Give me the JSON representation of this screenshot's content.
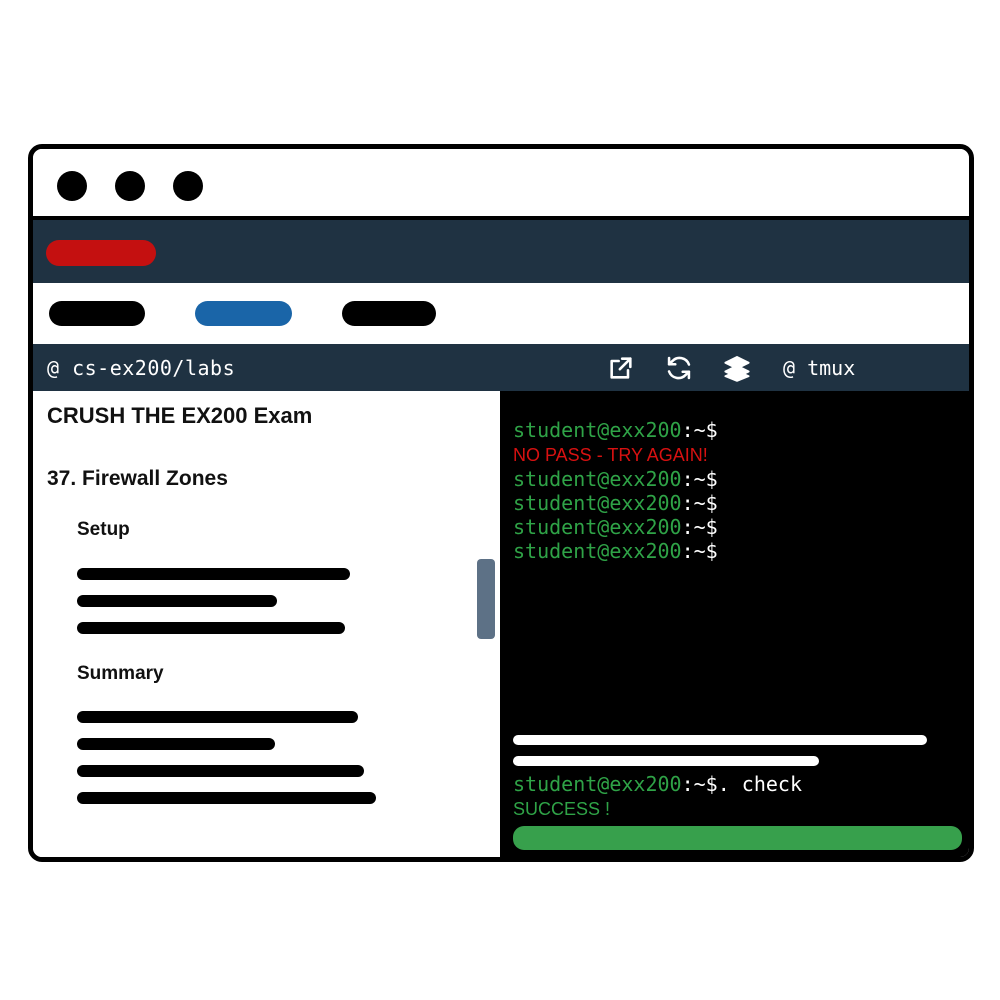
{
  "window": {
    "traffic_lights": [
      "close",
      "minimize",
      "maximize"
    ],
    "frame_color": "#000000"
  },
  "brandbar": {
    "color": "#1f3242",
    "logo_pill_color": "#c41010"
  },
  "navbar": {
    "pills": [
      {
        "name": "nav-pill-1",
        "color": "#000000",
        "active": false
      },
      {
        "name": "nav-pill-2",
        "color": "#1a65a8",
        "active": true
      },
      {
        "name": "nav-pill-3",
        "color": "#000000",
        "active": false
      }
    ]
  },
  "pathbar": {
    "path": "@ cs-ex200/labs",
    "background": "#1f3242",
    "icons": [
      {
        "name": "external-link-icon",
        "label": "open-in-new-window"
      },
      {
        "name": "refresh-icon",
        "label": "reload"
      },
      {
        "name": "layers-icon",
        "label": "layers"
      }
    ],
    "tmux_label": "@ tmux"
  },
  "document": {
    "title": "CRUSH THE EX200 Exam",
    "section": "37. Firewall Zones",
    "subsections": [
      {
        "heading": "Setup",
        "redacted_lines": 3
      },
      {
        "heading": "Summary",
        "redacted_lines": 4
      }
    ],
    "scrollbar_color": "#5d7186"
  },
  "terminal": {
    "background": "#000000",
    "prompt": "student@exx200",
    "prompt_suffix": ":~$",
    "prompt_color": "#2fa347",
    "suffix_color": "#ffffff",
    "lines": [
      {
        "type": "prompt",
        "prompt": "student@exx200",
        "suffix": ":~$",
        "command": ""
      },
      {
        "type": "error",
        "text": "NO PASS - TRY AGAIN!",
        "color": "#d81111"
      },
      {
        "type": "prompt",
        "prompt": "student@exx200",
        "suffix": ":~$",
        "command": ""
      },
      {
        "type": "prompt",
        "prompt": "student@exx200",
        "suffix": ":~$",
        "command": ""
      },
      {
        "type": "prompt",
        "prompt": "student@exx200",
        "suffix": ":~$",
        "command": ""
      },
      {
        "type": "prompt",
        "prompt": "student@exx200",
        "suffix": ":~$",
        "command": ""
      }
    ],
    "redacted_output_lines": 2,
    "check_line": {
      "prompt": "student@exx200",
      "suffix": ":~$.",
      "command": " check"
    },
    "result": {
      "text": "SUCCESS !",
      "color": "#2fa347"
    },
    "status_bar_color": "#37a04c"
  }
}
